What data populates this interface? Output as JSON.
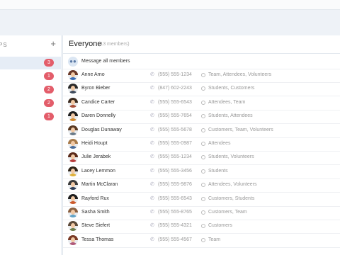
{
  "sidebar": {
    "title": "PS",
    "add_icon": "plus-icon",
    "items": [
      {
        "label": "",
        "badge": "3",
        "active": true
      },
      {
        "label": "",
        "badge": "1"
      },
      {
        "label": "s",
        "badge": "2"
      },
      {
        "label": "",
        "badge": "2"
      },
      {
        "label": "",
        "badge": "1"
      },
      {
        "label": "s",
        "badge": ""
      }
    ],
    "badge_color": "#e35d6a"
  },
  "main": {
    "title": "Everyone",
    "subtitle": "(13 members)",
    "message_all_label": "Message all members",
    "members": [
      {
        "name": "Anne Arno",
        "phone": "(555) 555-1234",
        "tags": "Team, Attendees, Volunteers"
      },
      {
        "name": "Byron Bieber",
        "phone": "(847) 602-2243",
        "tags": "Students, Customers"
      },
      {
        "name": "Candice Carter",
        "phone": "(555) 555-6543",
        "tags": "Attendees, Team"
      },
      {
        "name": "Daren Donnelly",
        "phone": "(555) 555-7654",
        "tags": "Students, Attendees"
      },
      {
        "name": "Douglas Dunaway",
        "phone": "(555) 555-5678",
        "tags": "Customers, Team, Volunteers"
      },
      {
        "name": "Heidi Houpt",
        "phone": "(555) 555-0987",
        "tags": "Attendees"
      },
      {
        "name": "Julie Jerabek",
        "phone": "(555) 555-1234",
        "tags": "Students, Volunteers"
      },
      {
        "name": "Lacey Lemmon",
        "phone": "(555) 555-3456",
        "tags": "Students"
      },
      {
        "name": "Martin McClaran",
        "phone": "(555) 555-9876",
        "tags": "Attendees, Volunteers"
      },
      {
        "name": "Rayford Rux",
        "phone": "(555) 555-6543",
        "tags": "Customers, Students"
      },
      {
        "name": "Sasha Smith",
        "phone": "(555) 555-8765",
        "tags": "Customers, Team"
      },
      {
        "name": "Steve Siefert",
        "phone": "(555) 555-4321",
        "tags": "Customers"
      },
      {
        "name": "Tessa Thomas",
        "phone": "(555) 555-4567",
        "tags": "Team"
      }
    ]
  }
}
